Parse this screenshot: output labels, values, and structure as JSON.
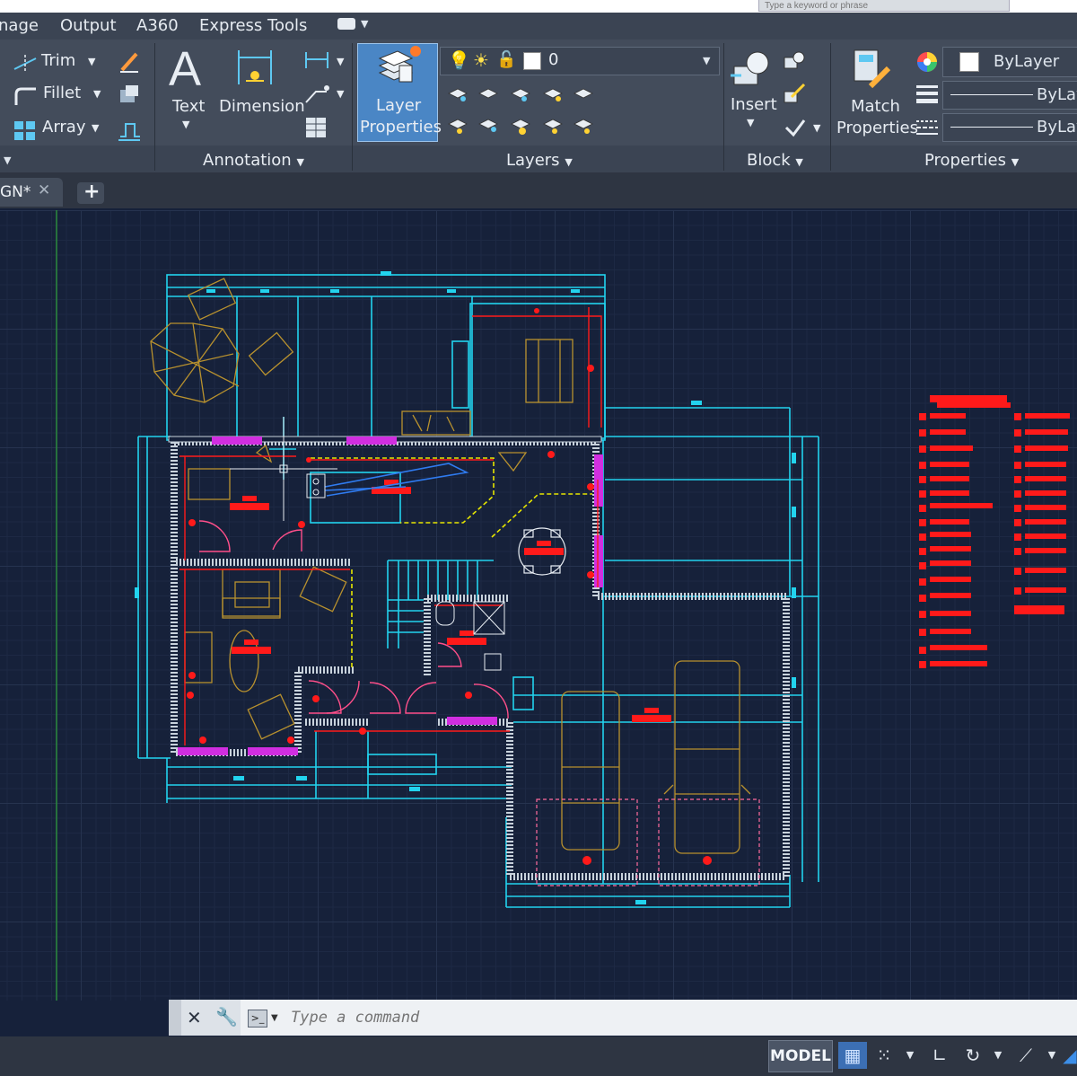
{
  "search": {
    "placeholder": "Type a keyword or phrase"
  },
  "menubar": {
    "items": [
      "nage",
      "Output",
      "A360",
      "Express Tools"
    ]
  },
  "ribbon": {
    "modify": {
      "trim_label": "Trim",
      "fillet_label": "Fillet",
      "array_label": "Array"
    },
    "annotation": {
      "text_label": "Text",
      "dimension_label": "Dimension",
      "panel_title": "Annotation"
    },
    "layers": {
      "layer_properties_label_1": "Layer",
      "layer_properties_label_2": "Properties",
      "current_layer": "0",
      "panel_title": "Layers"
    },
    "block": {
      "insert_label": "Insert",
      "panel_title": "Block"
    },
    "properties": {
      "match_label_1": "Match",
      "match_label_2": "Properties",
      "color_value": "ByLayer",
      "linetype_value": "ByLay",
      "lineweight_value": "ByLay",
      "panel_title": "Properties"
    }
  },
  "tabs": {
    "document_tab": "GN*"
  },
  "command_line": {
    "placeholder": "Type a command"
  },
  "status_bar": {
    "model_label": "MODEL"
  },
  "colors": {
    "canvas": "#16213a",
    "wall_cyan": "#22d3ee",
    "furniture_gold": "#b8912e",
    "annotation_red": "#ff1a1a",
    "window_magenta": "#d12ee0",
    "interior_yellow": "#e6e600",
    "ribbon_bg": "#434c5b"
  },
  "icons": [
    "trim-icon",
    "fillet-icon",
    "array-icon",
    "text-icon",
    "dimension-icon",
    "layer-properties-icon",
    "insert-block-icon",
    "match-properties-icon",
    "close-icon",
    "wrench-icon",
    "grid-icon",
    "snap-icon",
    "ortho-icon",
    "polar-icon"
  ]
}
